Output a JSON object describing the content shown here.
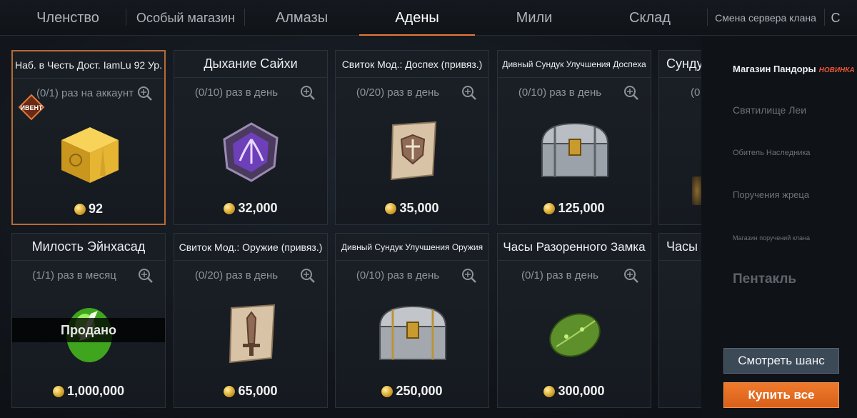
{
  "tabs": [
    {
      "label": "Членство"
    },
    {
      "label": "Особый магазин"
    },
    {
      "label": "Алмазы"
    },
    {
      "label": "Адены",
      "active": true
    },
    {
      "label": "Мили"
    },
    {
      "label": "Склад"
    },
    {
      "label": "Смена сервера клана"
    },
    {
      "label": "С"
    }
  ],
  "currency_icon": "adena-coin-icon",
  "accent_color": "#e8783a",
  "cards": [
    {
      "title": "Наб. в Честь Дост. IamLu 92 Ур.",
      "limit": "(0/1) раз на аккаунт",
      "price": "92",
      "icon": "gold-box-icon",
      "badge": "ИВЕНТ"
    },
    {
      "title": "Дыхание Сайхи",
      "limit": "(0/10) раз в день",
      "price": "32,000",
      "icon": "purple-crystal-icon"
    },
    {
      "title": "Свиток Мод.: Доспех (привяз.)",
      "limit": "(0/20) раз в день",
      "price": "35,000",
      "icon": "armor-scroll-icon"
    },
    {
      "title": "Дивный Сундук Улучшения Доспеха",
      "limit": "(0/10) раз в день",
      "price": "125,000",
      "icon": "silver-chest-icon"
    },
    {
      "title": "Сундук",
      "limit": "(0",
      "price": "",
      "icon": ""
    },
    {
      "title": "Милость Эйнхасад",
      "limit": "(1/1) раз в месяц",
      "price": "1,000,000",
      "icon": "green-crystal-icon",
      "sold": "Продано"
    },
    {
      "title": "Свиток Мод.: Оружие (привяз.)",
      "limit": "(0/20) раз в день",
      "price": "65,000",
      "icon": "weapon-scroll-icon"
    },
    {
      "title": "Дивный Сундук Улучшения Оружия",
      "limit": "(0/10) раз в день",
      "price": "250,000",
      "icon": "silver-chest-icon"
    },
    {
      "title": "Часы Разоренного Замка",
      "limit": "(0/1) раз в день",
      "price": "300,000",
      "icon": "green-leaf-icon"
    },
    {
      "title": "Часы .",
      "limit": "",
      "price": "",
      "icon": ""
    }
  ],
  "sidebar": {
    "items": [
      {
        "label": "Магазин Пандоры",
        "badge": "НОВИНКА",
        "active": true
      },
      {
        "label": "Святилище Леи"
      },
      {
        "label": "Обитель Наследника"
      },
      {
        "label": "Поручения жреца"
      },
      {
        "label": "Магазин поручений клана"
      },
      {
        "label": "Пентакль"
      }
    ]
  },
  "buttons": {
    "chance": "Смотреть шанс",
    "buy_all": "Купить все"
  }
}
